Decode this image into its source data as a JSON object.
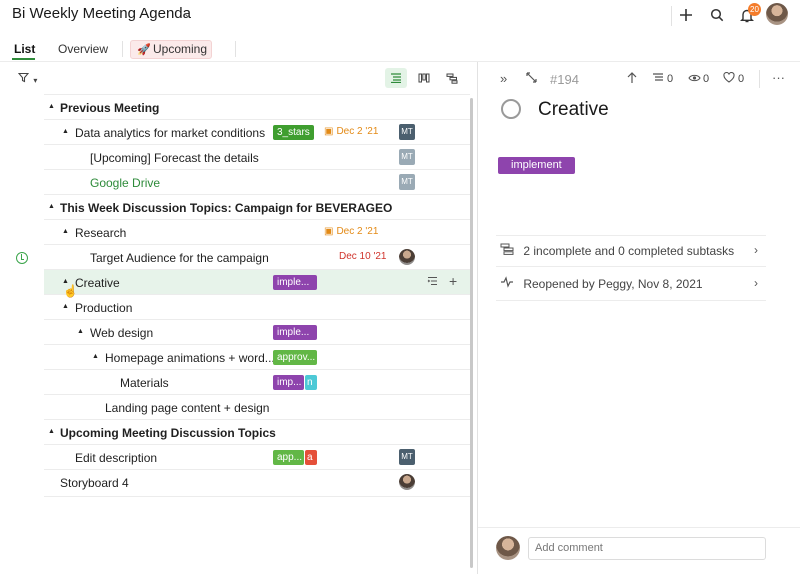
{
  "header": {
    "title": "Bi Weekly Meeting Agenda",
    "caret_icon": "chevron-down-icon",
    "notification_count": "20"
  },
  "tabs": [
    {
      "label": "List"
    },
    {
      "label": "Overview"
    },
    {
      "label": "Upcoming"
    }
  ],
  "toolbar": {
    "filter_icon": "filter-icon"
  },
  "list": {
    "rows": [
      {
        "text": "Previous Meeting"
      },
      {
        "text": "Data analytics for market conditions",
        "tag": "3_stars",
        "date": "Dec 2 '21",
        "assignee": "MT"
      },
      {
        "text": "[Upcoming] Forecast the details",
        "assignee": "MT"
      },
      {
        "text": "Google Drive",
        "assignee": "MT"
      },
      {
        "text": "This Week Discussion Topics: Campaign for BEVERAGEO"
      },
      {
        "text": "Research",
        "date": "Dec 2 '21"
      },
      {
        "text": "Target Audience for the campaign",
        "date": "Dec 10 '21"
      },
      {
        "text": "Creative",
        "tag": "imple..."
      },
      {
        "text": "Production"
      },
      {
        "text": "Web design",
        "tag": "imple..."
      },
      {
        "text": "Homepage animations + word...",
        "tag": "approv..."
      },
      {
        "text": "Materials",
        "tag": "imp...",
        "tag2": "n"
      },
      {
        "text": "Landing page content + design"
      },
      {
        "text": "Upcoming Meeting Discussion Topics"
      },
      {
        "text": "Edit description",
        "tag": "app...",
        "tag2": "a",
        "assignee": "MT"
      },
      {
        "text": "Storyboard 4"
      }
    ]
  },
  "detail": {
    "task_id": "#194",
    "subtask_count": "0",
    "watcher_count": "0",
    "like_count": "0",
    "title": "Creative",
    "tag": "implement",
    "subtasks_text": "2 incomplete and 0 completed subtasks",
    "activity_text": "Reopened by Peggy, Nov 8, 2021",
    "comment_placeholder": "Add comment"
  },
  "colors": {
    "accent": "#2e8b3a",
    "tag_purple": "#8e44ad",
    "tag_green": "#3f9e2f",
    "date_orange": "#e38a16",
    "date_red": "#d0342c"
  }
}
